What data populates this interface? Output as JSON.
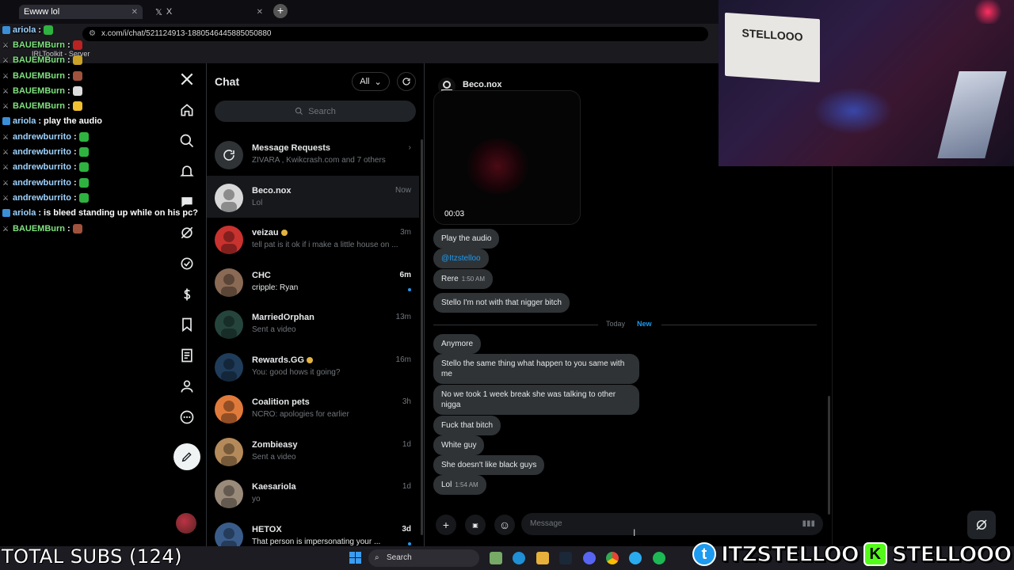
{
  "browser": {
    "tab1_title": "Ewww lol",
    "tab2_title": "X",
    "url": "x.com/i/chat/521124913-1880546445885050880",
    "bookmark": "IRLToolkit - Server"
  },
  "twitch_chat": [
    {
      "user": "ariola",
      "msg": "",
      "color": "#9fd3ff",
      "emote": "#2fb340"
    },
    {
      "user": "BAUEMBurn",
      "msg": "",
      "color": "#7fe37f",
      "emote": "#b22"
    },
    {
      "user": "BAUEMBurn",
      "msg": "",
      "color": "#7fe37f",
      "emote": "#c9a227"
    },
    {
      "user": "BAUEMBurn",
      "msg": "",
      "color": "#7fe37f",
      "emote": "#a0523d"
    },
    {
      "user": "BAUEMBurn",
      "msg": "",
      "color": "#7fe37f",
      "emote": "#dddddd"
    },
    {
      "user": "BAUEMBurn",
      "msg": "",
      "color": "#7fe37f",
      "emote": "#f0c030"
    },
    {
      "user": "ariola",
      "msg": "play the audio",
      "color": "#9fd3ff",
      "emote": ""
    },
    {
      "user": "andrewburrito",
      "msg": "",
      "color": "#9fd3ff",
      "emote": "#2fb340"
    },
    {
      "user": "andrewburrito",
      "msg": "",
      "color": "#9fd3ff",
      "emote": "#2fb340"
    },
    {
      "user": "andrewburrito",
      "msg": "",
      "color": "#9fd3ff",
      "emote": "#2fb340"
    },
    {
      "user": "andrewburrito",
      "msg": "",
      "color": "#9fd3ff",
      "emote": "#2fb340"
    },
    {
      "user": "andrewburrito",
      "msg": "",
      "color": "#9fd3ff",
      "emote": "#2fb340"
    },
    {
      "user": "ariola",
      "msg": "is bleed standing up while on his pc?",
      "color": "#9fd3ff",
      "emote": ""
    },
    {
      "user": "BAUEMBurn",
      "msg": "",
      "color": "#7fe37f",
      "emote": "#a0523d"
    }
  ],
  "chat_panel": {
    "title": "Chat",
    "filter": "All",
    "search_placeholder": "Search"
  },
  "conversations": [
    {
      "name": "Message Requests",
      "preview": "ZIVARA , Kwikcrash.com and 7 others",
      "time": "›",
      "avatar": "#2f3336",
      "unread": false,
      "active": false,
      "verified": false
    },
    {
      "name": "Beco.nox",
      "preview": "Lol",
      "time": "Now",
      "avatar": "#d8d8d8",
      "unread": false,
      "active": true,
      "verified": false
    },
    {
      "name": "veizau",
      "preview": "tell pat is it ok if i make a little house on ...",
      "time": "3m",
      "avatar": "#c8322f",
      "unread": false,
      "active": false,
      "verified": true
    },
    {
      "name": "CHC",
      "preview": "cripple: Ryan",
      "time": "6m",
      "avatar": "#8a6a55",
      "unread": true,
      "active": false,
      "verified": false
    },
    {
      "name": "MarriedOrphan",
      "preview": "Sent a video",
      "time": "13m",
      "avatar": "#25453c",
      "unread": false,
      "active": false,
      "verified": false
    },
    {
      "name": "Rewards.GG",
      "preview": "You: good hows it going?",
      "time": "16m",
      "avatar": "#1f3c5a",
      "unread": false,
      "active": false,
      "verified": true
    },
    {
      "name": "Coalition pets",
      "preview": "NCRO: apologies for earlier",
      "time": "3h",
      "avatar": "#e07a3b",
      "unread": false,
      "active": false,
      "verified": false
    },
    {
      "name": "Zombieasy",
      "preview": "Sent a video",
      "time": "1d",
      "avatar": "#b58a5a",
      "unread": false,
      "active": false,
      "verified": false
    },
    {
      "name": "Kaesariola",
      "preview": "yo",
      "time": "1d",
      "avatar": "#9a8a7a",
      "unread": false,
      "active": false,
      "verified": false
    },
    {
      "name": "HETOX",
      "preview": "That person is impersonating your ...",
      "time": "3d",
      "avatar": "#3a5c8a",
      "unread": true,
      "active": false,
      "verified": false
    }
  ],
  "thread": {
    "title": "Beco.nox",
    "video_duration": "00:03",
    "messages_before": [
      {
        "text": "Play the audio",
        "ts": ""
      },
      {
        "text": "@Itzstelloo",
        "ts": ""
      },
      {
        "text": "Rere",
        "ts": "1:50 AM"
      },
      {
        "text": "Stello I'm not with that nigger bitch",
        "ts": ""
      }
    ],
    "divider_today": "Today",
    "divider_new": "New",
    "messages_after": [
      {
        "text": "Anymore",
        "ts": ""
      },
      {
        "text": "Stello the same thing what happen to you same with me",
        "ts": ""
      },
      {
        "text": "No we took 1 week break she was talking to other nigga",
        "ts": ""
      },
      {
        "text": "Fuck that bitch",
        "ts": ""
      },
      {
        "text": "White guy",
        "ts": ""
      },
      {
        "text": "She doesn't like black guys",
        "ts": ""
      },
      {
        "text": "Lol",
        "ts": "1:54 AM"
      }
    ],
    "composer_placeholder": "Message"
  },
  "taskbar": {
    "search": "Search"
  },
  "overlay": {
    "subs": "TOTAL SUBS (124)",
    "twitter_handle": "ITZSTELLOO",
    "kick_handle": "STELLOOO",
    "cam_sign": "STELLOOO"
  },
  "icons": {
    "nav": [
      "x-logo-icon",
      "home-icon",
      "search-icon",
      "notifications-icon",
      "chat-icon",
      "grok-icon",
      "verified-icon",
      "monetization-icon",
      "bookmark-icon",
      "articles-icon",
      "profile-icon",
      "more-icon"
    ]
  }
}
